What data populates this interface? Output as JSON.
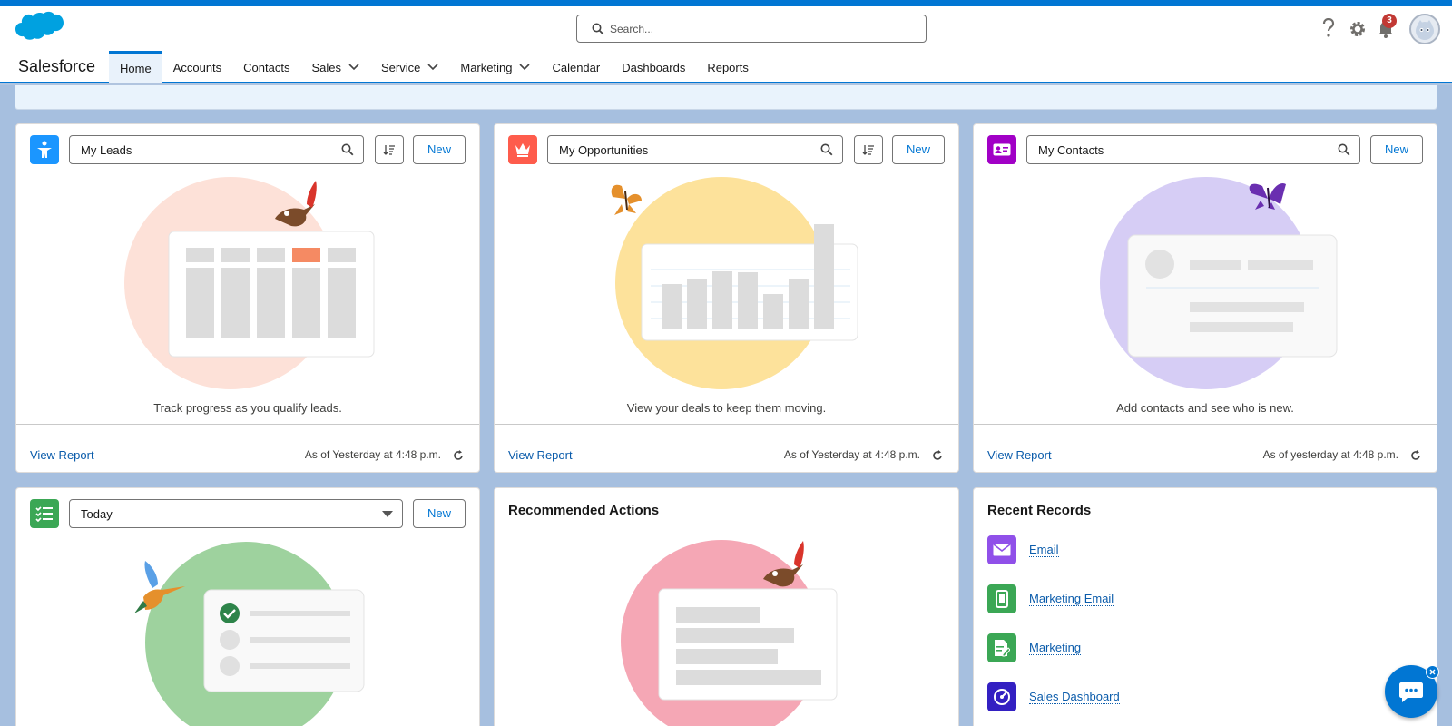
{
  "app": {
    "name": "Salesforce"
  },
  "search": {
    "placeholder": "Search..."
  },
  "utility": {
    "notification_count": "3",
    "icons": [
      "help-icon",
      "gear-icon",
      "bell-icon",
      "avatar"
    ]
  },
  "nav": {
    "items": [
      {
        "label": "Home",
        "active": true
      },
      {
        "label": "Accounts"
      },
      {
        "label": "Contacts"
      },
      {
        "label": "Sales",
        "dropdown": true
      },
      {
        "label": "Service",
        "dropdown": true
      },
      {
        "label": "Marketing",
        "dropdown": true
      },
      {
        "label": "Calendar"
      },
      {
        "label": "Dashboards"
      },
      {
        "label": "Reports"
      }
    ]
  },
  "cards": {
    "leads": {
      "picker": "My Leads",
      "new_label": "New",
      "caption": "Track progress as you qualify leads.",
      "view_report": "View Report",
      "as_of": "As of Yesterday at 4:48 p.m.",
      "icon_color": "#1b96ff",
      "circle_color": "#fde1d8"
    },
    "opportunities": {
      "picker": "My Opportunities",
      "new_label": "New",
      "caption": "View your deals to keep them moving.",
      "view_report": "View Report",
      "as_of": "As of Yesterday at 4:48 p.m.",
      "icon_color": "#fe5c4c",
      "circle_color": "#fde29b"
    },
    "contacts": {
      "picker": "My Contacts",
      "new_label": "New",
      "caption": "Add contacts and see who is new.",
      "view_report": "View Report",
      "as_of": "As of yesterday at 4:48 p.m.",
      "icon_color": "#a100c6",
      "circle_color": "#d6cdf5"
    },
    "tasks": {
      "picker": "Today",
      "new_label": "New",
      "icon_color": "#3ba755",
      "circle_color": "#9ed29e"
    },
    "recommended": {
      "title": "Recommended Actions",
      "circle_color": "#f5a7b5"
    },
    "recent": {
      "title": "Recent Records",
      "items": [
        {
          "label": "Email",
          "icon": "email-icon",
          "color": "#9050e9"
        },
        {
          "label": "Marketing Email",
          "icon": "mobile-icon",
          "color": "#3ba755"
        },
        {
          "label": "Marketing",
          "icon": "document-edit-icon",
          "color": "#3ba755"
        },
        {
          "label": "Sales Dashboard",
          "icon": "dashboard-icon",
          "color": "#3320c2"
        }
      ]
    }
  },
  "chat": {
    "icon": "chat-icon"
  }
}
